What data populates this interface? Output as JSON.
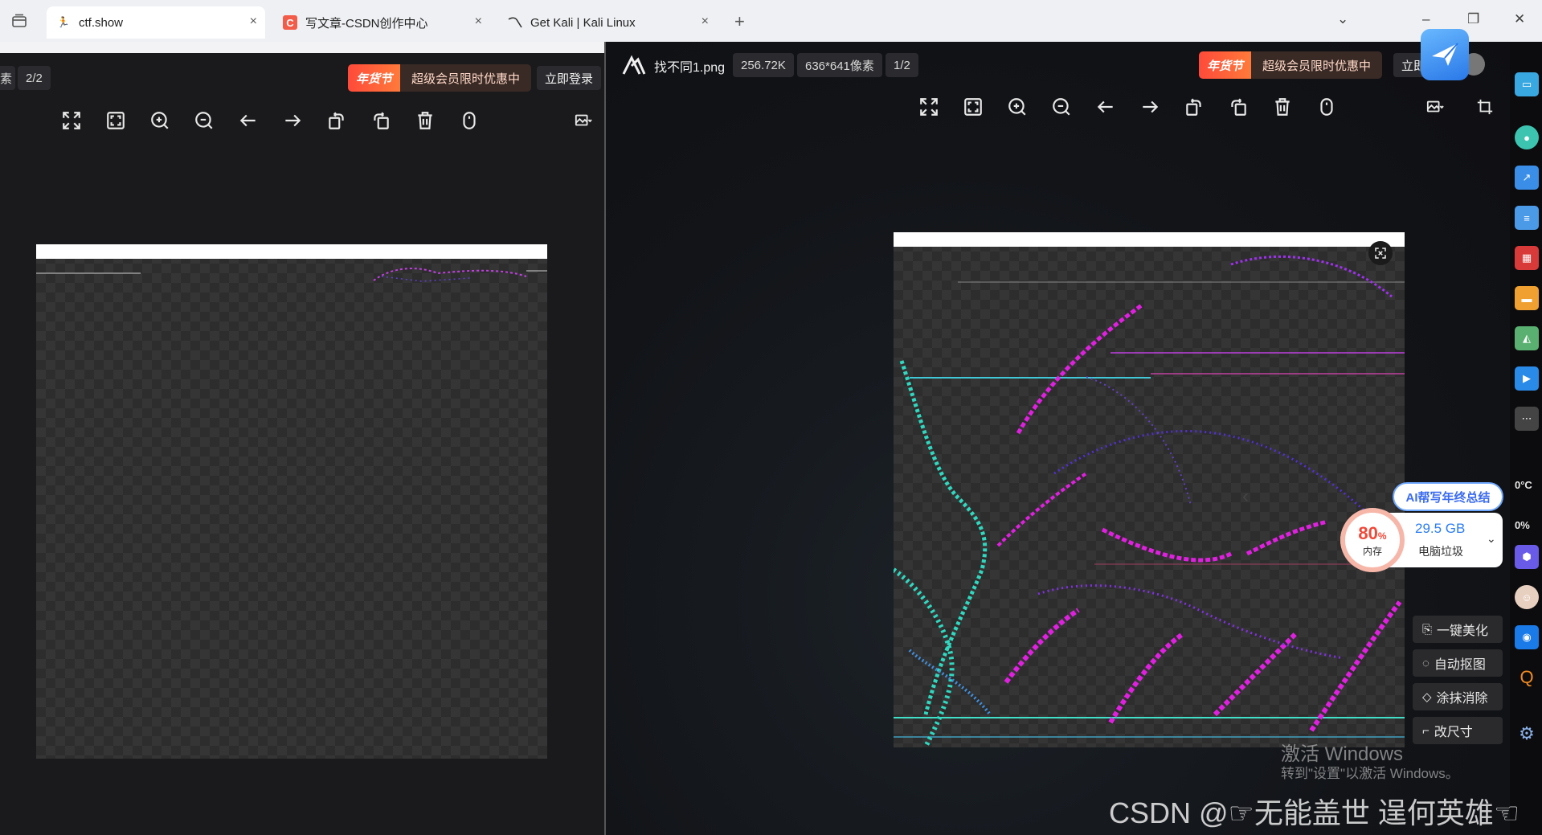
{
  "browser": {
    "tabs": [
      {
        "label": "ctf.show",
        "active": true
      },
      {
        "label": "写文章-CSDN创作中心",
        "active": false
      },
      {
        "label": "Get Kali | Kali Linux",
        "active": false
      }
    ],
    "new_tab": "+",
    "close_glyph": "×"
  },
  "left_viewer": {
    "partial_label": "素",
    "page_indicator": "2/2",
    "promo_tag": "年货节",
    "promo_text": "超级会员限时优惠中",
    "login": "立即登录"
  },
  "right_viewer": {
    "filename": "找不同1.png",
    "filesize": "256.72K",
    "dimensions": "636*641像素",
    "page_indicator": "1/2",
    "promo_tag": "年货节",
    "promo_text": "超级会员限时优惠中",
    "login": "立即"
  },
  "toolbar_icons": [
    "fullscreen-icon",
    "fit-icon",
    "zoom-in-icon",
    "zoom-out-icon",
    "prev-icon",
    "next-icon",
    "rotate-left-icon",
    "rotate-right-icon",
    "delete-icon",
    "mouse-icon"
  ],
  "ai_bubble": "AI帮写年终总结",
  "memory": {
    "percent": "80",
    "percent_unit": "%",
    "label": "内存",
    "junk_size": "29.5 GB",
    "junk_label": "电脑垃圾"
  },
  "side_actions": [
    {
      "label": "一键美化",
      "icon": "beautify-icon"
    },
    {
      "label": "自动抠图",
      "icon": "cutout-icon"
    },
    {
      "label": "涂抹消除",
      "icon": "eraser-icon"
    },
    {
      "label": "改尺寸",
      "icon": "resize-icon"
    }
  ],
  "dock": {
    "temp": "0°C",
    "cpu": "0%"
  },
  "watermark": {
    "activate_title": "激活 Windows",
    "activate_sub": "转到\"设置\"以激活 Windows。",
    "csdn": "CSDN @☞无能盖世 逞何英雄☜"
  }
}
